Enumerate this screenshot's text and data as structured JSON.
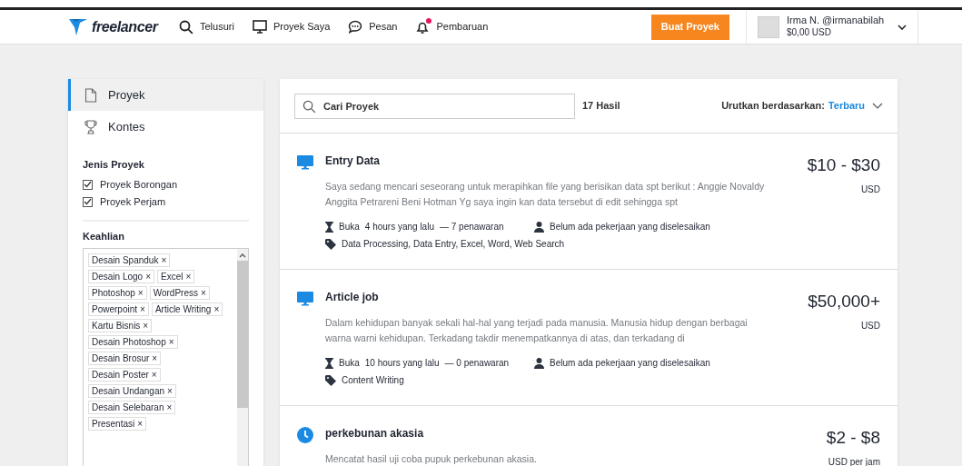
{
  "header": {
    "logo": "freelancer",
    "nav": [
      {
        "kind": "search",
        "label": "Telusuri"
      },
      {
        "kind": "monitor",
        "label": "Proyek Saya"
      },
      {
        "kind": "chat",
        "label": "Pesan"
      },
      {
        "kind": "bell",
        "label": "Pembaruan",
        "badge": true
      }
    ],
    "post_button": "Buat Proyek",
    "user": {
      "name": "Irma N. @irmanabilah",
      "balance": "$0,00 USD"
    }
  },
  "sidebar": {
    "items": [
      {
        "kind": "file",
        "label": "Proyek",
        "selected": true
      },
      {
        "kind": "trophy",
        "label": "Kontes",
        "selected": false
      }
    ],
    "project_type": {
      "title": "Jenis Proyek",
      "options": [
        {
          "label": "Proyek Borongan",
          "checked": true
        },
        {
          "label": "Proyek Perjam",
          "checked": true
        }
      ]
    },
    "skills": {
      "title": "Keahlian",
      "tags": [
        {
          "label": "Desain Spanduk",
          "remove": "×"
        },
        {
          "label": "Desain Logo",
          "remove": "×"
        },
        {
          "label": "Excel",
          "remove": "×"
        },
        {
          "label": "Photoshop",
          "remove": "×"
        },
        {
          "label": "WordPress",
          "remove": "×"
        },
        {
          "label": "Powerpoint",
          "remove": "×"
        },
        {
          "label": "Article Writing",
          "remove": "×"
        },
        {
          "label": "Kartu Bisnis",
          "remove": "×"
        },
        {
          "label": "Desain Photoshop",
          "remove": "×"
        },
        {
          "label": "Desain Brosur",
          "remove": "×"
        },
        {
          "label": "Desain Poster",
          "remove": "×"
        },
        {
          "label": "Desain Undangan",
          "remove": "×"
        },
        {
          "label": "Desain Selebaran",
          "remove": "×"
        },
        {
          "label": "Presentasi",
          "remove": "×"
        }
      ]
    }
  },
  "search": {
    "placeholder": "Cari Proyek",
    "count": "17 Hasil",
    "sort_label": "Urutkan berdasarkan:",
    "sort_value": "Terbaru"
  },
  "jobs": [
    {
      "kind": "fixed",
      "title": "Entry Data",
      "description": "Saya sedang mencari seseorang untuk merapihkan file yang berisikan data spt berikut : Anggie Novaldy Anggita Petrareni Beni Hotman Yg saya ingin kan data tersebut di edit sehingga spt",
      "status": "Buka",
      "age": "4 hours yang lalu",
      "bids": "— 7 penawaran",
      "history": "Belum ada pekerjaan yang diselesaikan",
      "skills": "Data Processing, Data Entry, Excel, Word, Web Search",
      "price": "$10 - $30",
      "currency": "USD"
    },
    {
      "kind": "fixed",
      "title": "Article job",
      "description": "Dalam kehidupan banyak sekali hal-hal yang terjadi pada manusia. Manusia hidup dengan berbagai warna warni kehidupan. Terkadang takdir menempatkannya di atas, dan terkadang di",
      "status": "Buka",
      "age": "10 hours yang lalu",
      "bids": "— 0 penawaran",
      "history": "Belum ada pekerjaan yang diselesaikan",
      "skills": "Content Writing",
      "price": "$50,000+",
      "currency": "USD"
    },
    {
      "kind": "hourly",
      "title": "perkebunan akasia",
      "description": "Mencatat hasil uji coba pupuk perkebunan akasia.",
      "price": "$2 - $8",
      "currency": "USD per jam"
    }
  ]
}
